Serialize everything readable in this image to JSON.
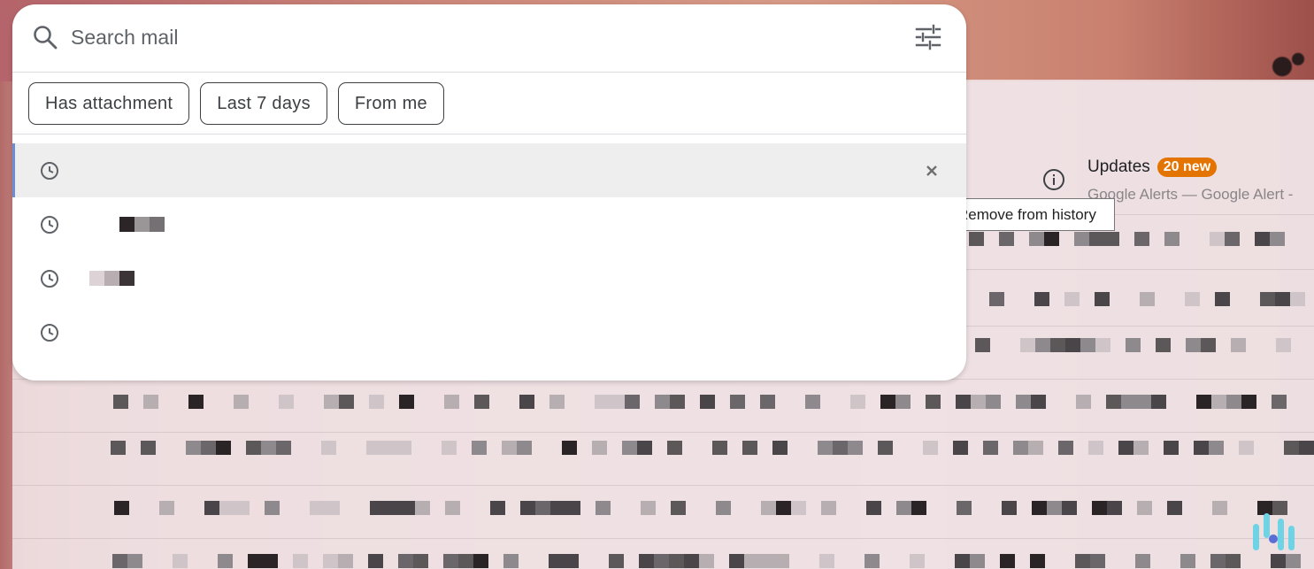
{
  "search": {
    "placeholder": "Search mail"
  },
  "chips": [
    {
      "label": "Has attachment"
    },
    {
      "label": "Last 7 days"
    },
    {
      "label": "From me"
    }
  ],
  "history": [
    {
      "text": ""
    },
    {
      "text": ""
    },
    {
      "text": ""
    },
    {
      "text": ""
    }
  ],
  "tooltip": {
    "text": "Remove from history"
  },
  "updates": {
    "title": "Updates",
    "badge": "20 new",
    "snippet": "Google Alerts — Google Alert -"
  },
  "colors": {
    "badge": "#e37400",
    "active_row": "#eeeeee",
    "active_indicator": "#6b8fd6"
  },
  "icons": {
    "search": "search-icon",
    "tune": "tune-icon",
    "history": "clock-icon",
    "remove": "close-icon",
    "info": "info-icon"
  }
}
